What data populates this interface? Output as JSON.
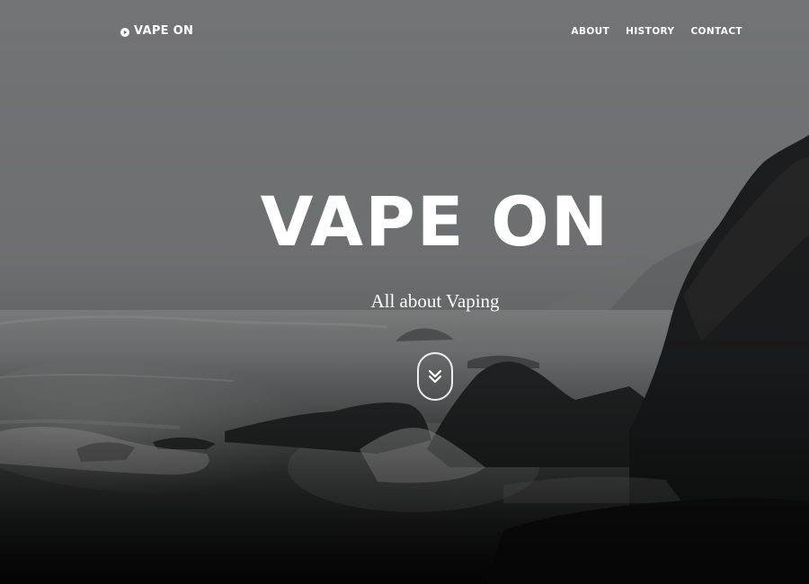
{
  "navbar": {
    "brand": {
      "icon": "play-circle-icon",
      "label": "VAPE ON"
    },
    "links": [
      {
        "label": "ABOUT"
      },
      {
        "label": "HISTORY"
      },
      {
        "label": "CONTACT"
      }
    ]
  },
  "hero": {
    "title": "VAPE ON",
    "subtitle": "All about Vaping",
    "scroll_button": {
      "icon": "double-chevron-down-icon"
    },
    "background": {
      "photo_tone": "grayscale",
      "overlay_bottom": "#0d0d0d"
    }
  },
  "colors": {
    "text": "#ffffff",
    "sky": "#717273",
    "rock": "#1e1f20"
  }
}
